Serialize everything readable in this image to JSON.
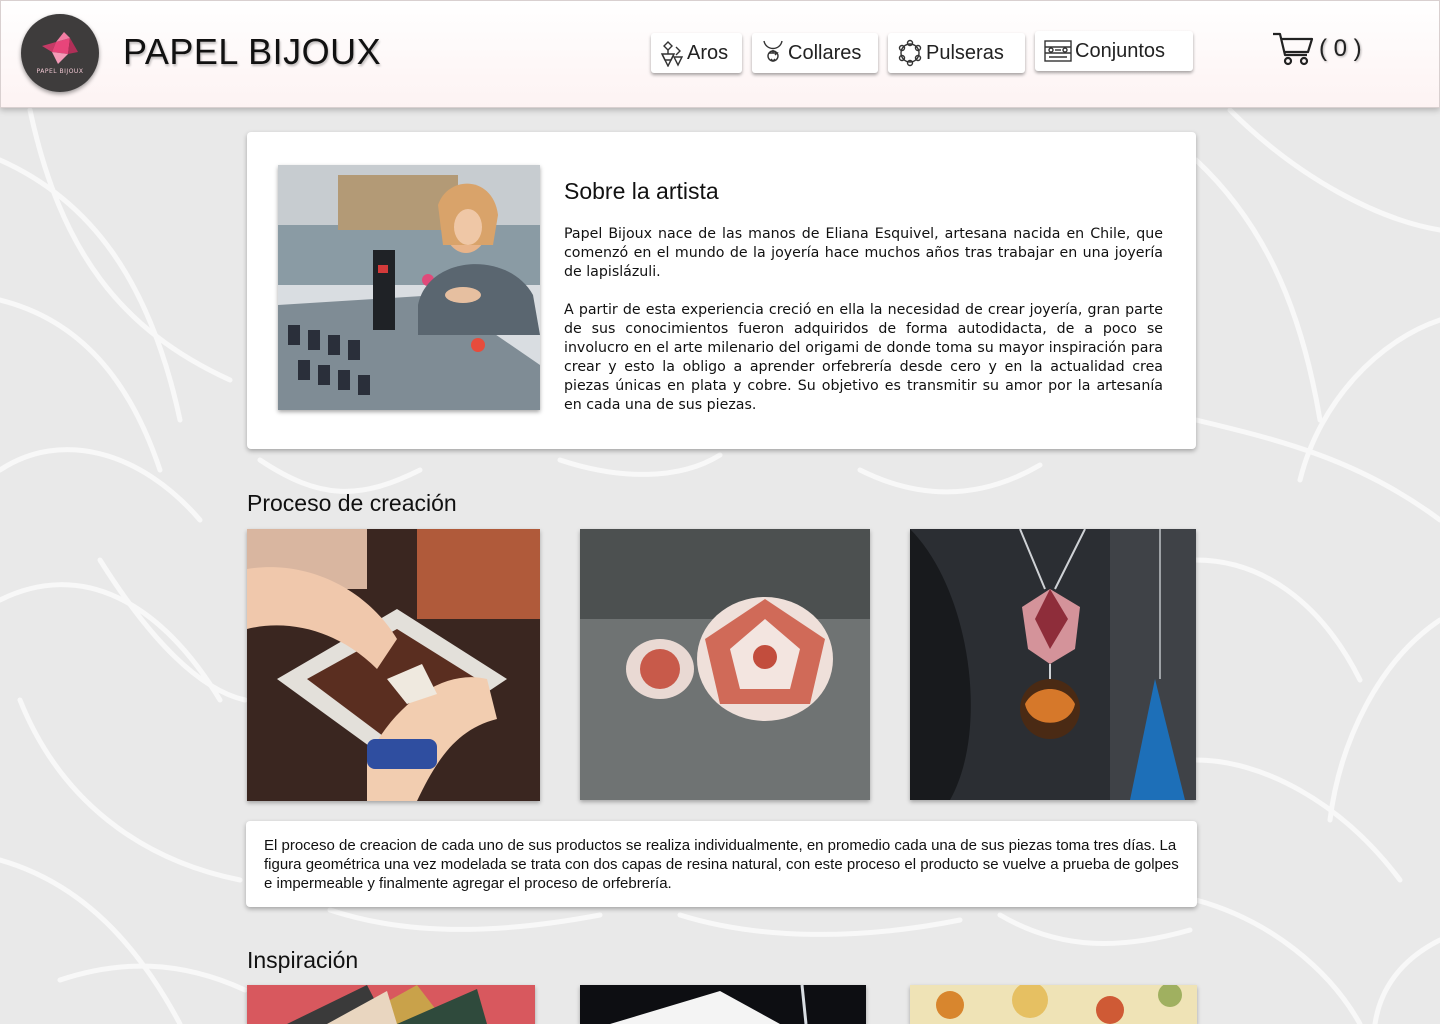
{
  "brand": {
    "name": "PAPEL BIJOUX",
    "logo_text": "PAPEL BIJOUX",
    "logo_icon": "origami-bird-icon"
  },
  "nav": [
    {
      "label": "Aros",
      "icon": "earrings-icon"
    },
    {
      "label": "Collares",
      "icon": "necklace-icon"
    },
    {
      "label": "Pulseras",
      "icon": "bracelet-icon"
    },
    {
      "label": "Conjuntos",
      "icon": "jewelry-box-icon"
    }
  ],
  "cart": {
    "count_label": "( 0 )",
    "icon": "shopping-cart-icon"
  },
  "about": {
    "title": "Sobre la artista",
    "paragraphs": [
      "Papel Bijoux nace de las manos de Eliana Esquivel, artesana nacida en Chile, que comenzó en el mundo de la joyería hace muchos años tras trabajar en una joyería de lapislázuli.",
      "A partir de esta experiencia creció en ella la necesidad de crear joyería, gran parte de sus conocimientos fueron adquiridos de forma autodidacta, de a poco se involucro en el arte milenario del origami de donde toma su mayor inspiración para crear y esto la obligo a aprender orfebrería desde cero y en la actualidad crea piezas únicas en plata y cobre. Su objetivo es transmitir su amor por la artesanía en cada una de sus piezas."
    ]
  },
  "process": {
    "title": "Proceso de creación",
    "text": "El proceso de creacion de cada uno de sus productos se realiza individualmente, en promedio cada una de sus piezas toma tres días. La figura geométrica una vez modelada se trata con dos capas de resina natural, con este proceso el producto se vuelve a prueba de golpes e impermeable y finalmente agregar el proceso de orfebrería."
  },
  "inspiration": {
    "title": "Inspiración"
  },
  "colors": {
    "accent": "#e8457a",
    "logo_bg": "#3e3c3c",
    "header_bg": "#fdf3f3",
    "page_bg": "#e9e9e9"
  }
}
